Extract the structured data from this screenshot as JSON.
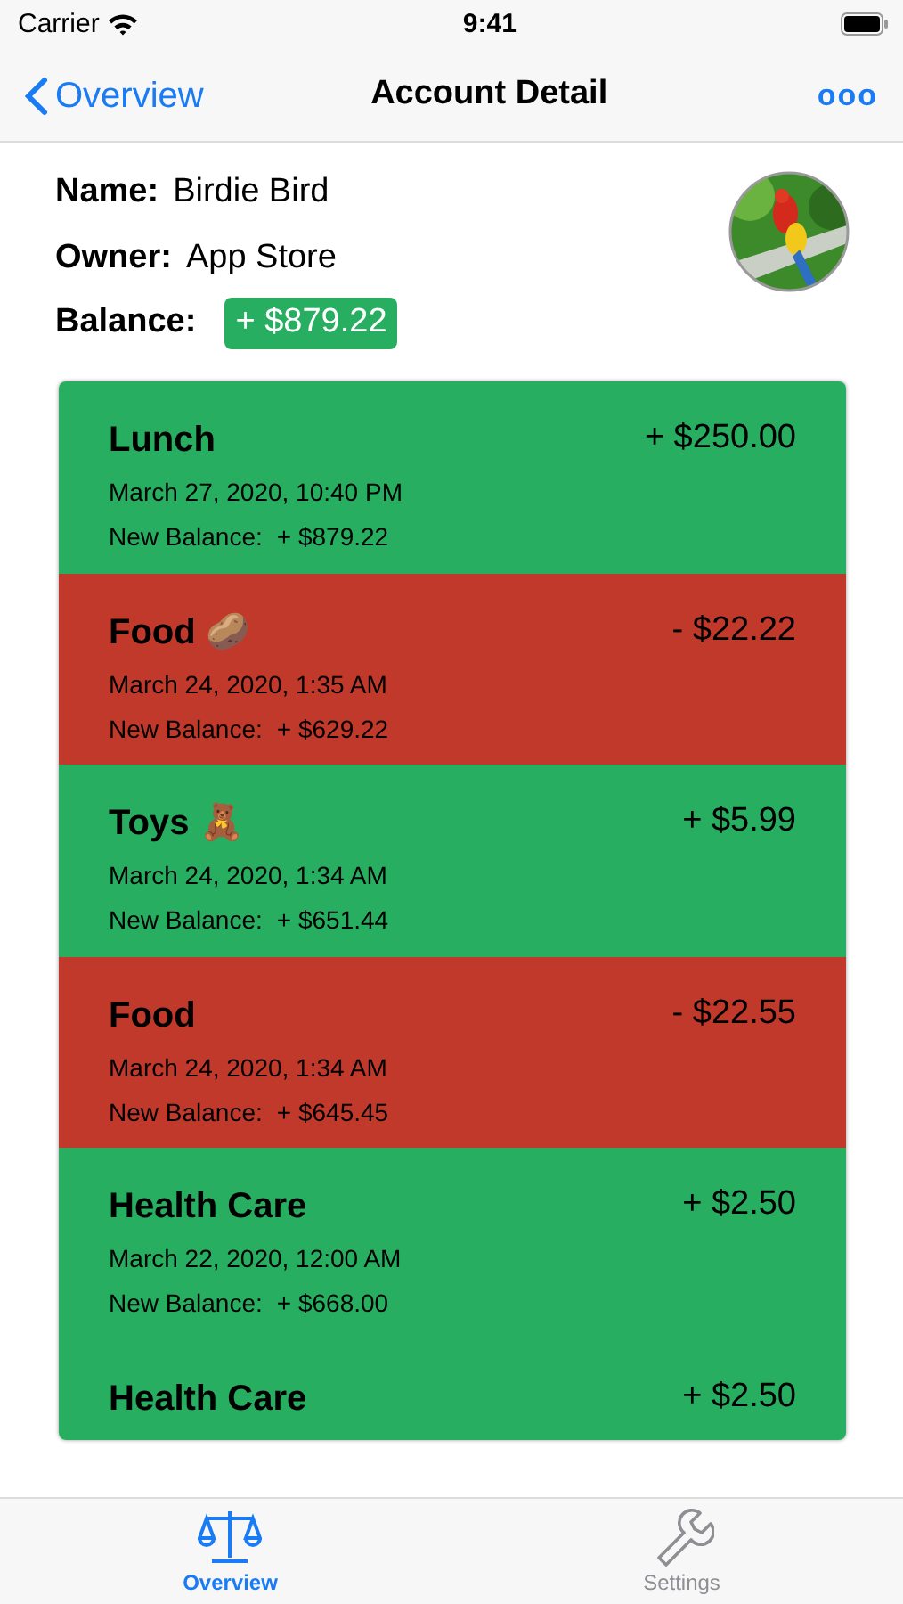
{
  "status_bar": {
    "carrier": "Carrier",
    "time": "9:41"
  },
  "nav": {
    "back": "Overview",
    "title": "Account Detail",
    "more": "ooo"
  },
  "account": {
    "fields": [
      {
        "label": "Name:",
        "value": "Birdie Bird",
        "kind": "text"
      },
      {
        "label": "Owner:",
        "value": "App Store",
        "kind": "text"
      },
      {
        "label": "Balance:",
        "value": "+ $879.22",
        "kind": "badge"
      }
    ]
  },
  "transactions": [
    {
      "title": "Lunch",
      "amount": "+ $250.00",
      "date": "March 27, 2020, 10:40 PM",
      "balance_label": "New Balance:",
      "balance": "+ $879.22",
      "kind": "income"
    },
    {
      "title": "Food 🥔",
      "amount": "- $22.22",
      "date": "March 24, 2020, 1:35 AM",
      "balance_label": "New Balance:",
      "balance": "+ $629.22",
      "kind": "expense"
    },
    {
      "title": "Toys 🧸",
      "amount": "+ $5.99",
      "date": "March 24, 2020, 1:34 AM",
      "balance_label": "New Balance:",
      "balance": "+ $651.44",
      "kind": "income"
    },
    {
      "title": "Food",
      "amount": "- $22.55",
      "date": "March 24, 2020, 1:34 AM",
      "balance_label": "New Balance:",
      "balance": "+ $645.45",
      "kind": "expense"
    },
    {
      "title": "Health Care",
      "amount": "+ $2.50",
      "date": "March 22, 2020, 12:00 AM",
      "balance_label": "New Balance:",
      "balance": "+ $668.00",
      "kind": "income"
    },
    {
      "title": "Health Care",
      "amount": "+ $2.50",
      "kind": "income"
    }
  ],
  "tab_bar": [
    {
      "label": "Overview",
      "selected": true
    },
    {
      "label": "Settings",
      "selected": false
    }
  ]
}
